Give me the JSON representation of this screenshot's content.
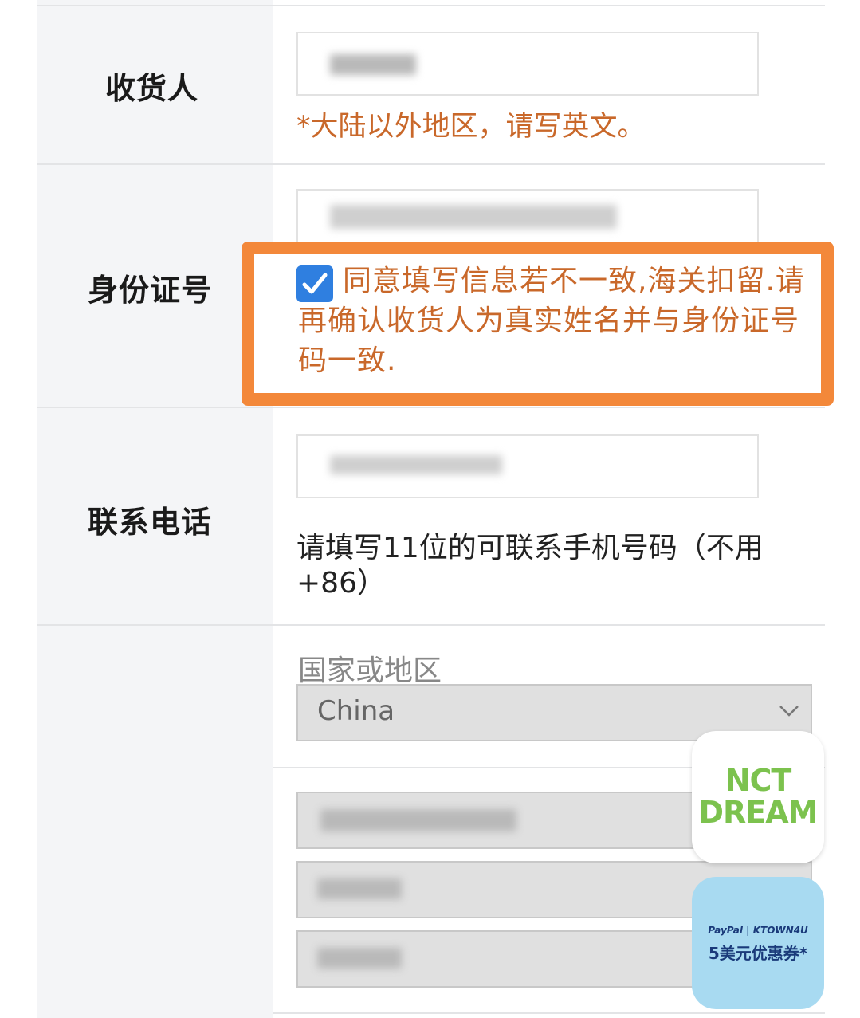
{
  "form": {
    "recipient": {
      "label": "收货人",
      "note": "*大陆以外地区，请写英文。"
    },
    "id_number": {
      "label": "身份证号",
      "consent_checked": true,
      "consent_text": "同意填写信息若不一致,海关扣留.请再确认收货人为真实姓名并与身份证号码一致."
    },
    "phone": {
      "label": "联系电话",
      "help": "请填写11位的可联系手机号码（不用+86）"
    },
    "address": {
      "country_label": "国家或地区",
      "country_value": "China"
    }
  },
  "badges": {
    "nct_line1": "NCT",
    "nct_line2": "DREAM",
    "paypal_top": "PayPal | KTOWN4U",
    "paypal_main": "5美元优惠券*"
  },
  "colors": {
    "highlight": "#f3883a",
    "note": "#c9682a",
    "checkbox": "#2f7fe0",
    "nct_green": "#7cc24e",
    "paypal_bg": "#a8daf1"
  }
}
